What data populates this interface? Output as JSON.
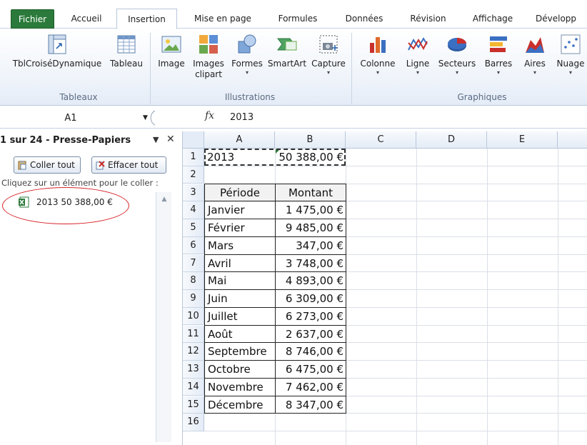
{
  "tabs": [
    {
      "label": "Fichier"
    },
    {
      "label": "Accueil"
    },
    {
      "label": "Insertion"
    },
    {
      "label": "Mise en page"
    },
    {
      "label": "Formules"
    },
    {
      "label": "Données"
    },
    {
      "label": "Révision"
    },
    {
      "label": "Affichage"
    },
    {
      "label": "Développ"
    }
  ],
  "ribbon": {
    "groups": {
      "tableaux": "Tableaux",
      "illustrations": "Illustrations",
      "graphiques": "Graphiques"
    },
    "buttons": {
      "pivot": "TblCroiséDynamique",
      "table": "Tableau",
      "image": "Image",
      "clipart_1": "Images",
      "clipart_2": "clipart",
      "shapes": "Formes",
      "smartart": "SmartArt",
      "capture": "Capture",
      "column": "Colonne",
      "line": "Ligne",
      "pie": "Secteurs",
      "bar": "Barres",
      "area": "Aires",
      "scatter": "Nuage"
    }
  },
  "formula_bar": {
    "name_box": "A1",
    "fx": "fx",
    "value": "2013"
  },
  "clipboard": {
    "title": "1 sur 24 - Presse-Papiers",
    "paste_all": "Coller tout",
    "clear_all": "Effacer tout",
    "hint": "Cliquez sur un élément pour le coller :",
    "items": [
      "2013 50 388,00 €"
    ]
  },
  "sheet": {
    "columns": [
      "A",
      "B",
      "C",
      "D",
      "E"
    ],
    "rows": [
      "1",
      "2",
      "3",
      "4",
      "5",
      "6",
      "7",
      "8",
      "9",
      "10",
      "11",
      "12",
      "13",
      "14",
      "15",
      "16"
    ],
    "a1": "2013",
    "b1": "50 388,00 €",
    "table_headers": [
      "Période",
      "Montant"
    ],
    "table_rows": [
      {
        "month": "Janvier",
        "amount": "1 475,00 €"
      },
      {
        "month": "Février",
        "amount": "9 485,00 €"
      },
      {
        "month": "Mars",
        "amount": "347,00 €"
      },
      {
        "month": "Avril",
        "amount": "3 748,00 €"
      },
      {
        "month": "Mai",
        "amount": "4 893,00 €"
      },
      {
        "month": "Juin",
        "amount": "6 309,00 €"
      },
      {
        "month": "Juillet",
        "amount": "6 273,00 €"
      },
      {
        "month": "Août",
        "amount": "2 637,00 €"
      },
      {
        "month": "Septembre",
        "amount": "8 746,00 €"
      },
      {
        "month": "Octobre",
        "amount": "6 475,00 €"
      },
      {
        "month": "Novembre",
        "amount": "7 462,00 €"
      },
      {
        "month": "Décembre",
        "amount": "8 347,00 €"
      }
    ]
  },
  "colors": {
    "file_tab": "#2b7a3b",
    "annotation_circle": "#d9262c",
    "header_fill": "#e4ecf7"
  }
}
